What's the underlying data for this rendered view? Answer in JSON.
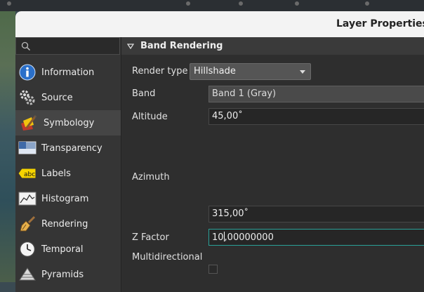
{
  "window": {
    "title": "Layer Properties -"
  },
  "sidebar": {
    "search_placeholder": "",
    "items": [
      {
        "label": "Information",
        "icon": "information-icon"
      },
      {
        "label": "Source",
        "icon": "source-icon"
      },
      {
        "label": "Symbology",
        "icon": "symbology-icon",
        "active": true
      },
      {
        "label": "Transparency",
        "icon": "transparency-icon"
      },
      {
        "label": "Labels",
        "icon": "labels-icon",
        "badge": "abc"
      },
      {
        "label": "Histogram",
        "icon": "histogram-icon"
      },
      {
        "label": "Rendering",
        "icon": "rendering-icon"
      },
      {
        "label": "Temporal",
        "icon": "temporal-icon"
      },
      {
        "label": "Pyramids",
        "icon": "pyramids-icon"
      }
    ]
  },
  "band_rendering": {
    "section_title": "Band Rendering",
    "render_type_label": "Render type",
    "render_type_value": "Hillshade",
    "band_label": "Band",
    "band_value": "Band 1 (Gray)",
    "altitude_label": "Altitude",
    "altitude_value": "45,00˚",
    "azimuth_label": "Azimuth",
    "azimuth_value": "315,00˚",
    "zfactor_label": "Z Factor",
    "zfactor_value_before_caret": "10",
    "zfactor_value_after_caret": ",00000000",
    "multidirectional_label": "Multidirectional",
    "multidirectional_checked": false
  },
  "colors": {
    "accent_focus": "#2aa198",
    "info_blue": "#2a6fc9"
  }
}
